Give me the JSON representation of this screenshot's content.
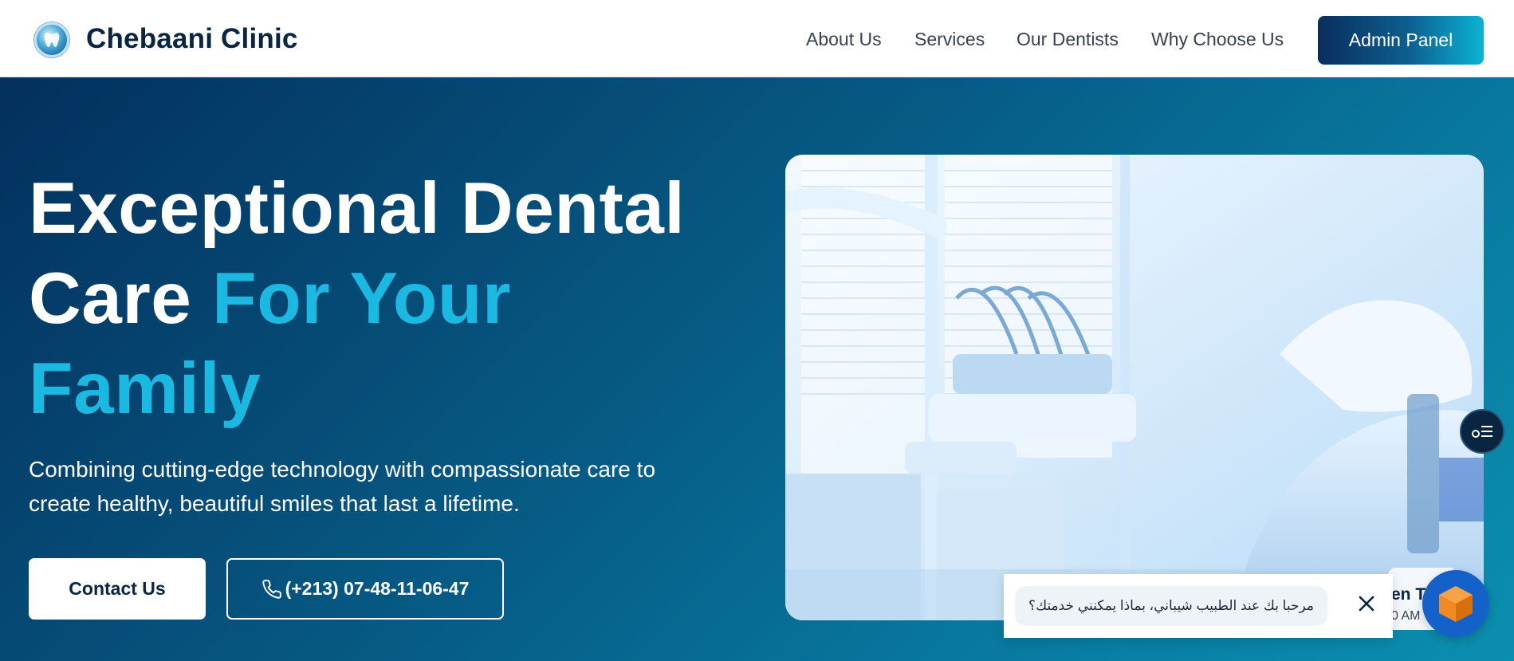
{
  "header": {
    "brand": "Chebaani Clinic",
    "nav": [
      {
        "label": "About Us"
      },
      {
        "label": "Services"
      },
      {
        "label": "Our Dentists"
      },
      {
        "label": "Why Choose Us"
      }
    ],
    "admin_label": "Admin Panel"
  },
  "hero": {
    "headline_line1": "Exceptional Dental",
    "headline_line2_plain": "Care ",
    "headline_line2_accent": "For Your",
    "headline_line3_accent": "Family",
    "subtext": "Combining cutting-edge technology with compassionate care to create healthy, beautiful smiles that last a lifetime.",
    "contact_label": "Contact Us",
    "phone_label": "(+213) 07-48-11-06-47"
  },
  "chat": {
    "message": "مرحبا بك عند الطبيب شيباني، بماذا يمكنني خدمتك؟",
    "peek_title": "en T",
    "peek_time": "0 AM"
  },
  "colors": {
    "brand_dark": "#0a2540",
    "accent": "#1bb8e2",
    "hero_gradient_start": "#04305d",
    "hero_gradient_end": "#0b8fae",
    "launcher": "#1462c9"
  },
  "icons": [
    "clinic-logo-icon",
    "phone-icon",
    "menu-lines-icon",
    "close-icon",
    "chat-cube-icon"
  ]
}
